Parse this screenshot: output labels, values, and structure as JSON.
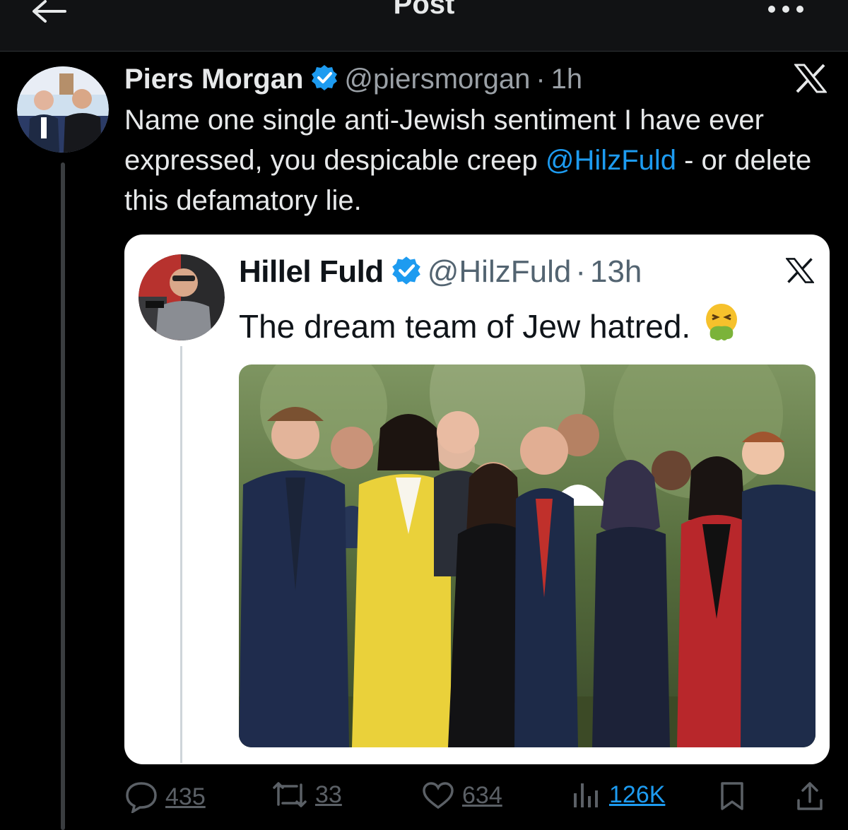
{
  "header": {
    "title": "Post"
  },
  "tweet": {
    "author_name": "Piers Morgan",
    "handle": "@piersmorgan",
    "separator": "·",
    "time": "1h",
    "text_before": "Name one single anti-Jewish sentiment I have ever expressed, you despicable creep ",
    "mention": "@HilzFuld",
    "text_after": " - or delete this defamatory lie."
  },
  "quoted": {
    "author_name": "Hillel Fuld",
    "handle": "@HilzFuld",
    "separator": "·",
    "time": "13h",
    "text": "The dream team of Jew hatred."
  },
  "actions": {
    "replies": "435",
    "reposts": "33",
    "likes": "634",
    "views": "126K"
  },
  "colors": {
    "accent": "#1d9bf0",
    "background": "#000000",
    "header_bg": "#111214",
    "verified": "#1d9bf0"
  },
  "icons": [
    "back-arrow-icon",
    "more-icon",
    "verified-badge-icon",
    "x-logo-icon",
    "nauseated-face-emoji-icon",
    "reply-icon",
    "repost-icon",
    "like-icon",
    "views-icon",
    "bookmark-icon",
    "share-icon"
  ]
}
